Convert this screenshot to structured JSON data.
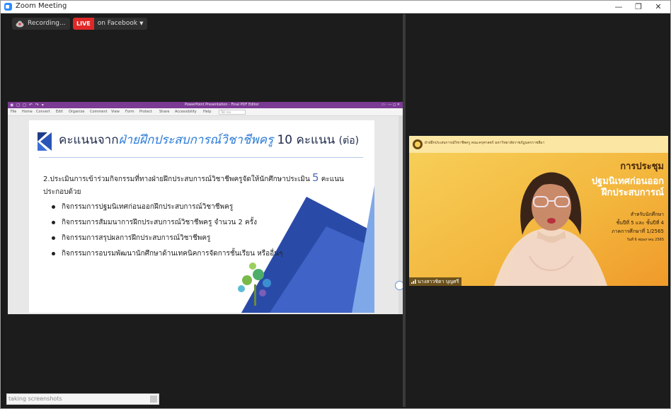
{
  "window": {
    "title": "Zoom Meeting",
    "minimize": "—",
    "restore": "❐",
    "close": "✕"
  },
  "recording": {
    "label": "Recording...",
    "icon": "cloud-record-icon"
  },
  "live": {
    "badge": "LIVE",
    "destination": "on Facebook",
    "caret": "▼"
  },
  "ppt": {
    "quick_access": "◉ ◻ ◻ ↶ ↷ ▾",
    "doc_title": "PowerPoint Presentation - Final PDF Editor",
    "window_controls": "▭ ·  —  ◻  ✕",
    "menu": [
      "File",
      "Home",
      "Convert",
      "Edit",
      "Organize",
      "Comment",
      "View",
      "Form",
      "Protect",
      "Share",
      "Accessibility",
      "Help"
    ],
    "tell_me": "Tell me",
    "slide": {
      "title_prefix": "คะแนนจาก",
      "title_highlight": "ฝ่ายฝึกประสบการณ์วิชาชีพครู",
      "title_suffix": "10 คะแนน",
      "title_note": "(ต่อ)",
      "body_line1_a": "2.ประเมินการเข้าร่วมกิจกรรมที่ทางฝ่ายฝึกประสบการณ์วิชาชีพครูจัดให้นักศึกษาประเมิน",
      "body_line1_num": "5",
      "body_line1_b": "คะแนน",
      "body_line2": "ประกอบด้วย",
      "bullets": [
        "กิจกรรมการปฐมนิเทศก่อนออกฝึกประสบการณ์วิชาชีพครู",
        "กิจกรรมการสัมมนาการฝึกประสบการณ์วิชาชีพครู จำนวน 2 ครั้ง",
        "กิจกรรมการสรุปผลการฝึกประสบการณ์วิชาชีพครู",
        "กิจกรรมการอบรมพัฒนานักศึกษาด้านเทคนิคการจัดการชั้นเรียน หรืออื่นๆ"
      ]
    }
  },
  "video": {
    "header": "ฝ่ายฝึกประสบการณ์วิชาชีพครู คณะครุศาสตร์ มหาวิทยาลัยราชภัฏนครราชสีมา",
    "heading": "การประชุม",
    "line1": "ปฐมนิเทศก่อนออก",
    "line2": "ฝึกประสบการณ์",
    "small1": "สำหรับนักศึกษา",
    "small2": "ชั้นปีที่ 5 และ ชั้นปีที่ 4",
    "small3": "ภาคการศึกษาที่ 1/2565",
    "small4": "วันที่ 6 พฤษภาคม 2565",
    "name_tag": "นางสาวชิตา บุญศรี"
  },
  "status_bar": {
    "text": "taking screenshots"
  }
}
